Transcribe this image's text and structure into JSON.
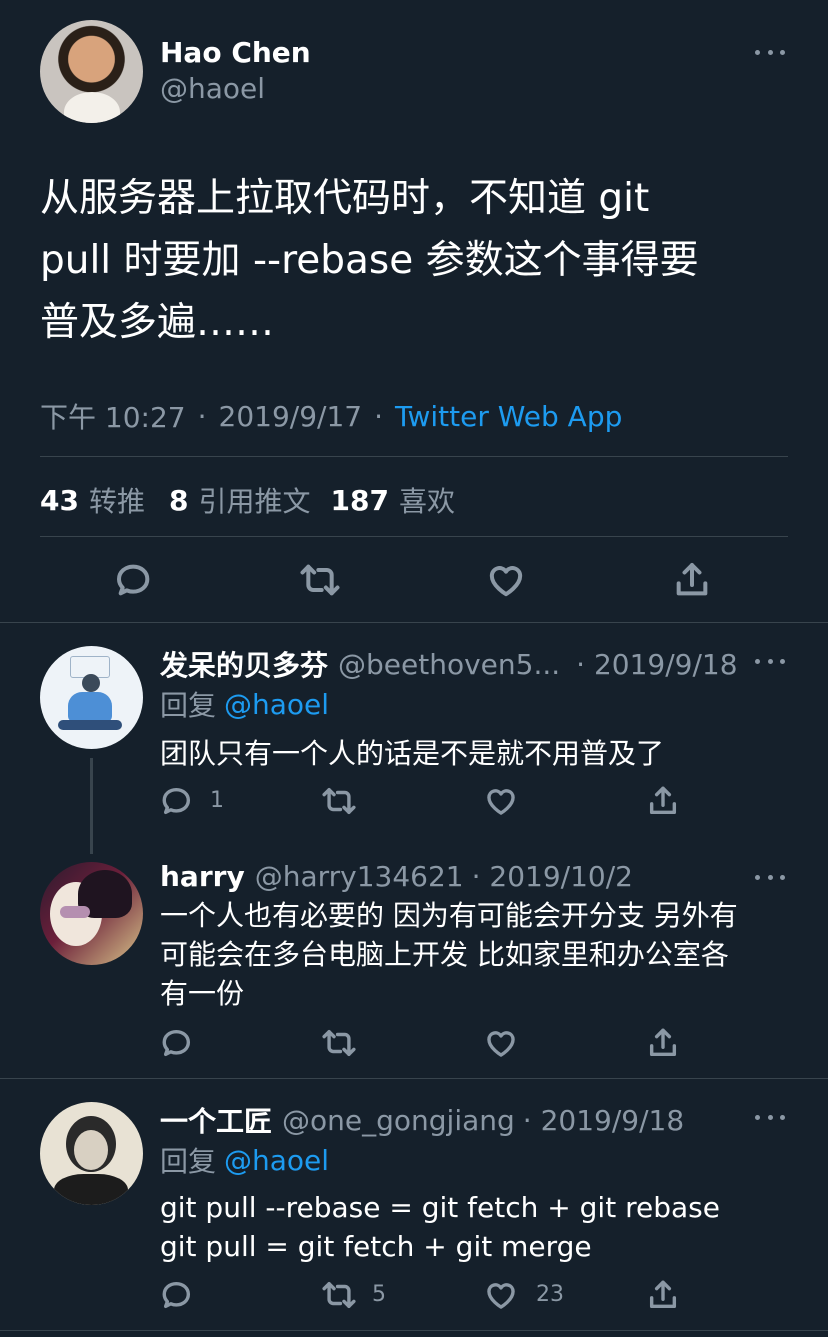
{
  "tweet": {
    "author_name": "Hao Chen",
    "author_handle": "@haoel",
    "text_line1": "从服务器上拉取代码时，不知道 git",
    "text_line2": "pull 时要加 --rebase  参数这个事得要",
    "text_line3": "普及多遍……",
    "time": "下午 10:27",
    "sep1": "·",
    "date": "2019/9/17",
    "sep2": "·",
    "source": "Twitter Web App",
    "retweet_count": "43",
    "retweet_label": "转推",
    "quote_count": "8",
    "quote_label": "引用推文",
    "like_count": "187",
    "like_label": "喜欢"
  },
  "replies": [
    {
      "name": "发呆的贝多芬",
      "handle": "@beethoven5...",
      "date": "· 2019/9/18",
      "reply_prefix": "回复",
      "reply_to": "@haoel",
      "text": "团队只有一个人的话是不是就不用普及了",
      "reply_count": "1",
      "retweet_count": "",
      "like_count": ""
    },
    {
      "name": "harry",
      "handle": "@harry134621",
      "date": "· 2019/10/2",
      "text_line1": "一个人也有必要的 因为有可能会开分支 另外有",
      "text_line2": "可能会在多台电脑上开发 比如家里和办公室各",
      "text_line3": "有一份",
      "reply_count": "",
      "retweet_count": "",
      "like_count": ""
    },
    {
      "name": "一个工匠",
      "handle": "@one_gongjiang",
      "date": "· 2019/9/18",
      "reply_prefix": "回复",
      "reply_to": "@haoel",
      "text_line1": "git pull --rebase = git fetch + git rebase",
      "text_line2": "git pull = git fetch + git merge",
      "reply_count": "",
      "retweet_count": "5",
      "like_count": "23"
    }
  ],
  "colors": {
    "background": "#15202b",
    "text": "#ffffff",
    "muted": "#8b98a5",
    "link": "#1d9bf0",
    "divider": "#38444d"
  }
}
